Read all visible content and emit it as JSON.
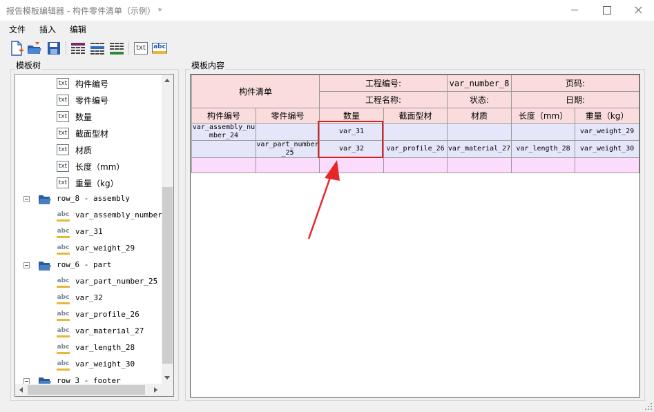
{
  "window": {
    "title": "报告模板编辑器 - 构件零件清单（示例） *"
  },
  "menu": {
    "items": [
      "文件",
      "插入",
      "编辑"
    ]
  },
  "toolbar": {
    "buttons": [
      "new-file-icon",
      "open-folder-icon",
      "save-icon",
      "table-icon",
      "table-blue-icon",
      "table-green-icon",
      "text-field-icon",
      "variable-field-icon"
    ],
    "txt_label": "txt",
    "abc_label": "abc"
  },
  "tree_panel": {
    "title": "模板树",
    "icons": {
      "txt": "txt",
      "abc": "abc"
    },
    "items": [
      {
        "type": "txt",
        "label": "构件编号"
      },
      {
        "type": "txt",
        "label": "零件编号"
      },
      {
        "type": "txt",
        "label": "数量"
      },
      {
        "type": "txt",
        "label": "截面型材"
      },
      {
        "type": "txt",
        "label": "材质"
      },
      {
        "type": "txt",
        "label": "长度（mm）"
      },
      {
        "type": "txt",
        "label": "重量（kg）"
      },
      {
        "type": "folder",
        "label": "row_8 - assembly"
      },
      {
        "type": "abc",
        "label": "var_assembly_number_24"
      },
      {
        "type": "abc",
        "label": "var_31"
      },
      {
        "type": "abc",
        "label": "var_weight_29"
      },
      {
        "type": "folder",
        "label": "row_6 - part"
      },
      {
        "type": "abc",
        "label": "var_part_number_25"
      },
      {
        "type": "abc",
        "label": "var_32"
      },
      {
        "type": "abc",
        "label": "var_profile_26"
      },
      {
        "type": "abc",
        "label": "var_material_27"
      },
      {
        "type": "abc",
        "label": "var_length_28"
      },
      {
        "type": "abc",
        "label": "var_weight_30"
      },
      {
        "type": "folder",
        "label": "row_3 - footer"
      }
    ]
  },
  "content_panel": {
    "title": "模板内容",
    "header": {
      "title": "构件清单",
      "project_no_label": "工程编号:",
      "project_no_value": "var_number_8",
      "page_label": "页码:",
      "project_name_label": "工程名称:",
      "status_label": "状态:",
      "date_label": "日期:"
    },
    "columns": [
      "构件编号",
      "零件编号",
      "数量",
      "截面型材",
      "材质",
      "长度（mm）",
      "重量（kg）"
    ],
    "assembly_row": {
      "assembly_number": "var_assembly_number_24",
      "quantity": "var_31",
      "weight": "var_weight_29"
    },
    "part_row": {
      "part_number": "var_part_number_25",
      "quantity": "var_32",
      "profile": "var_profile_26",
      "material": "var_material_27",
      "length": "var_length_28",
      "weight": "var_weight_30"
    }
  },
  "colors": {
    "header_pink": "#fadcdc",
    "row_blue": "#e6e6fa",
    "row_pink": "#fcdcfc",
    "highlight_red": "#e02020"
  }
}
